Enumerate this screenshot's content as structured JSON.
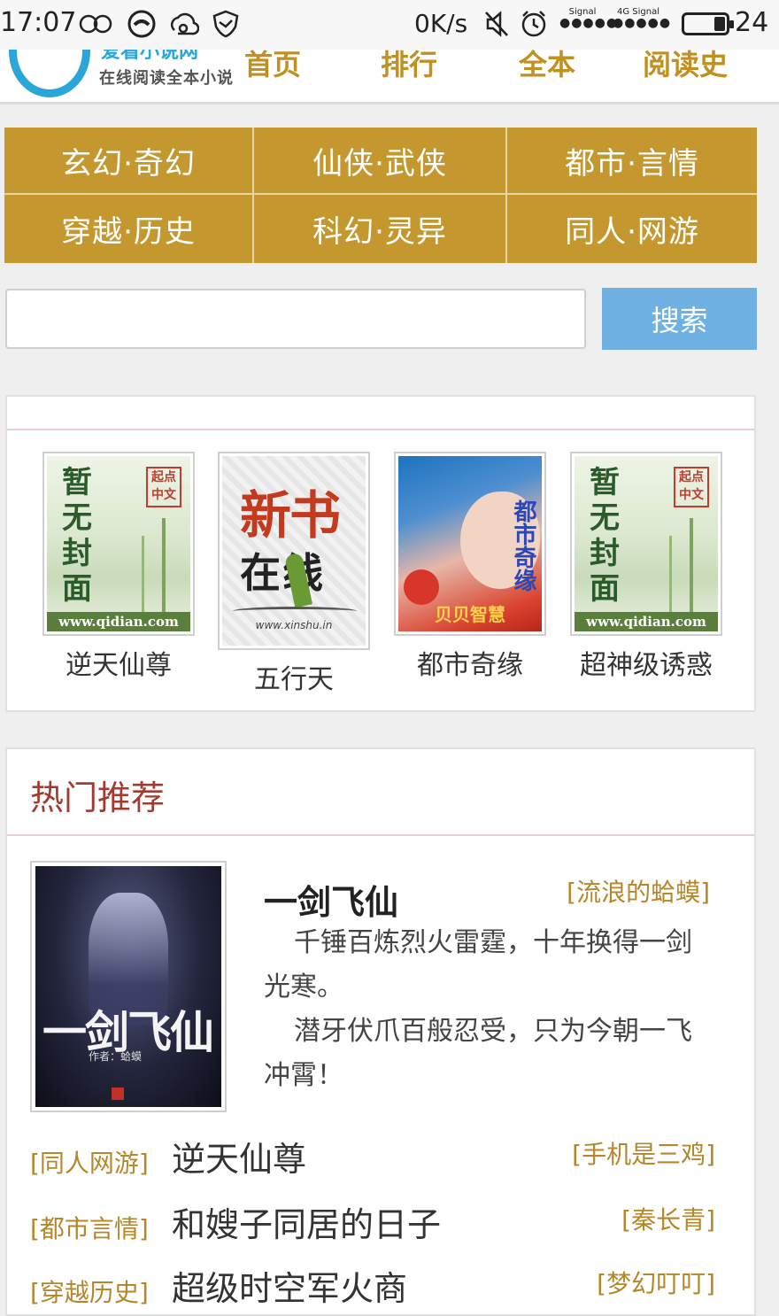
{
  "status_bar": {
    "time": "17:07",
    "net_speed": "0K/s",
    "signal_label_1": "Signal",
    "signal_label_2": "Signal",
    "network_type": "4G",
    "battery": "24"
  },
  "header": {
    "logo_text_top": "爱看小说网",
    "logo_subtitle": "在线阅读全本小说",
    "nav": [
      "首页",
      "排行",
      "全本",
      "阅读史"
    ]
  },
  "categories": [
    "玄幻·奇幻",
    "仙侠·武侠",
    "都市·言情",
    "穿越·历史",
    "科幻·灵异",
    "同人·网游"
  ],
  "search": {
    "value": "",
    "placeholder": "",
    "button_label": "搜索"
  },
  "featured_books": [
    {
      "title": "逆天仙尊",
      "cover_text": "暂无封面",
      "cover_seal": "起点中文",
      "cover_url": "www.qidian.com"
    },
    {
      "title": "五行天",
      "cover_text_1": "新书",
      "cover_text_2": "在线",
      "cover_url": "www.xinshu.in"
    },
    {
      "title": "都市奇缘",
      "cover_text": "都市奇缘",
      "cover_author": "贝贝智慧"
    },
    {
      "title": "超神级诱惑",
      "cover_text": "暂无封面",
      "cover_seal": "起点中文",
      "cover_url": "www.qidian.com"
    }
  ],
  "hot": {
    "title": "热门推荐",
    "featured": {
      "name": "一剑飞仙",
      "author": "[流浪的蛤蟆]",
      "cover_text": "一剑飞仙",
      "cover_author": "作者：蛤蟆",
      "desc": [
        "千锤百炼烈火雷霆，十年换得一剑光寒。",
        "潜牙伏爪百般忍受，只为今朝一飞冲霄！"
      ]
    },
    "list": [
      {
        "category": "[同人网游]",
        "title": "逆天仙尊",
        "author": "[手机是三鸡]"
      },
      {
        "category": "[都市言情]",
        "title": "和嫂子同居的日子",
        "author": "[秦长青]"
      },
      {
        "category": "[穿越历史]",
        "title": "超级时空军火商",
        "author": "[梦幻叮叮]"
      }
    ]
  },
  "colors": {
    "gold": "#c4982f",
    "blue": "#6fb1e3",
    "logo_blue": "#2aa7d8",
    "title_red": "#a43a2f"
  }
}
